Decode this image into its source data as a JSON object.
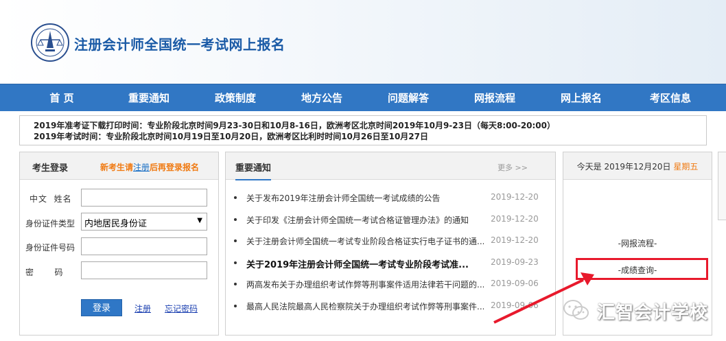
{
  "header": {
    "title": "注册会计师全国统一考试网上报名"
  },
  "nav": [
    "首  页",
    "重要通知",
    "政策制度",
    "地方公告",
    "问题解答",
    "网报流程",
    "网上报名",
    "考区信息"
  ],
  "notice": {
    "line1": "2019年准考证下载打印时间：专业阶段北京时间9月23-30日和10月8-16日，欧洲考区北京时间2019年10月9-23日（每天8:00-20:00）",
    "line2": "2019年考试时间：专业阶段北京时间10月19日至10月20日，欧洲考区比利时时间10月26日至10月27日"
  },
  "login": {
    "title": "考生登录",
    "tip_prefix": "新考生请",
    "tip_link": "注册",
    "tip_suffix": "后再登录报名",
    "name_label": "中文  姓名",
    "idtype_label": "身份证件类型",
    "idtype_value": "内地居民身份证",
    "idno_label": "身份证件号码",
    "password_label": "密        码",
    "login_button": "登录",
    "register_link": "注册",
    "forgot_link": "忘记密码"
  },
  "news": {
    "title": "重要通知",
    "more": "更多 >>",
    "items": [
      {
        "text": "关于发布2019年注册会计师全国统一考试成绩的公告",
        "date": "2019-12-20"
      },
      {
        "text": "关于印发《注册会计师全国统一考试合格证管理办法》的通知",
        "date": "2019-12-20"
      },
      {
        "text": "关于注册会计师全国统一考试专业阶段合格证实行电子证书的通...",
        "date": "2019-12-20"
      },
      {
        "text": "关于2019年注册会计师全国统一考试专业阶段考试准...",
        "date": "2019-09-23"
      },
      {
        "text": "两高发布关于办理组织考试作弊等刑事案件适用法律若干问题的...",
        "date": "2019-09-06"
      },
      {
        "text": "最高人民法院最高人民检察院关于办理组织考试作弊等刑事案件...",
        "date": "2019-09-06"
      }
    ]
  },
  "side": {
    "date_prefix": "今天是 2019年12月20日",
    "weekday": "星期五",
    "link1": "-网报流程-",
    "link2": "-成绩查询-"
  },
  "watermark": {
    "text": "汇智会计学校"
  },
  "colors": {
    "nav_bg": "#3177c4",
    "title_blue": "#1a5aa6",
    "accent_orange": "#f07a12",
    "highlight_red": "#e8192c"
  }
}
